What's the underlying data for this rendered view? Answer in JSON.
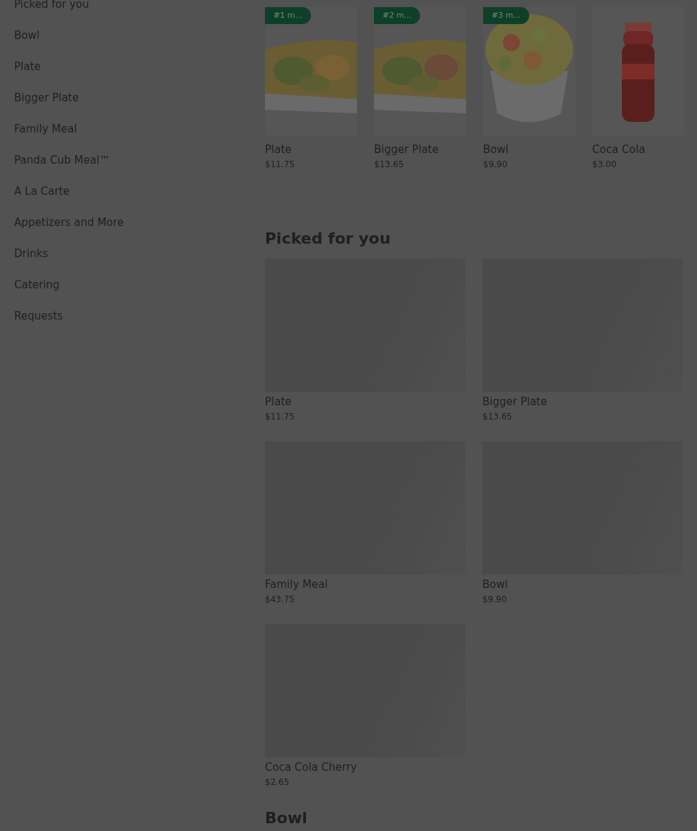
{
  "sidebar": {
    "items": [
      {
        "label": "Picked for you"
      },
      {
        "label": "Bowl"
      },
      {
        "label": "Plate"
      },
      {
        "label": "Bigger Plate"
      },
      {
        "label": "Family Meal"
      },
      {
        "label": "Panda Cub Meal™"
      },
      {
        "label": "A La Carte"
      },
      {
        "label": "Appetizers and More"
      },
      {
        "label": "Drinks"
      },
      {
        "label": "Catering"
      },
      {
        "label": "Requests"
      }
    ]
  },
  "featured": [
    {
      "badge": "#1 m...",
      "name": "Plate",
      "price": "$11.75"
    },
    {
      "badge": "#2 m...",
      "name": "Bigger Plate",
      "price": "$13.65"
    },
    {
      "badge": "#3 m...",
      "name": "Bowl",
      "price": "$9.90"
    },
    {
      "name": "Coca Cola",
      "price": "$3.00"
    }
  ],
  "sections": [
    {
      "title": "Picked for you",
      "items": [
        {
          "name": "Plate",
          "price": "$11.75"
        },
        {
          "name": "Bigger Plate",
          "price": "$13.65"
        },
        {
          "name": "Family Meal",
          "price": "$43.75"
        },
        {
          "name": "Bowl",
          "price": "$9.90"
        },
        {
          "name": "Coca Cola Cherry",
          "price": "$2.65"
        }
      ]
    }
  ],
  "next_section": {
    "title": "Bowl"
  }
}
